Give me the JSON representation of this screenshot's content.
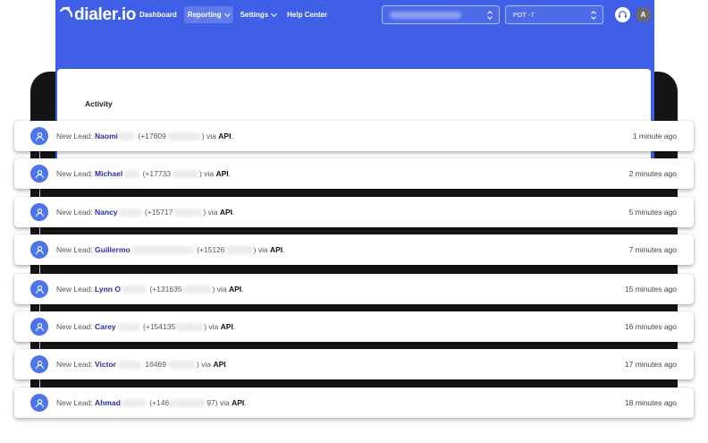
{
  "app": {
    "logo_text": "dialer.io",
    "nav": [
      {
        "label": "Dashboard"
      },
      {
        "label": "Reporting"
      },
      {
        "label": "Settings"
      },
      {
        "label": "Help Center"
      }
    ],
    "timezone": "PDT -7",
    "user_initial": "A"
  },
  "activity": {
    "title": "Activity",
    "prefix": "New Lead:",
    "via_word": "via",
    "activities": [
      {
        "name": "Naomi",
        "phone": "(+17809",
        "phone_end": ")",
        "source": "API",
        "time": "1 minute ago"
      },
      {
        "name": "Michael",
        "phone": "(+17733",
        "phone_end": ")",
        "source": "API",
        "time": "2 minutes ago"
      },
      {
        "name": "Nancy",
        "phone": "(+15717",
        "phone_end": ")",
        "source": "API",
        "time": "5 minutes ago"
      },
      {
        "name": "Guillermo",
        "phone": "(+15126",
        "phone_end": ")",
        "source": "API",
        "time": "7 minutes ago"
      },
      {
        "name": "Lynn O",
        "phone": "(+131635",
        "phone_end": ")",
        "source": "API",
        "time": "15 minutes ago"
      },
      {
        "name": "Carey",
        "phone": "(+154135",
        "phone_end": ")",
        "source": "API",
        "time": "16 minutes ago"
      },
      {
        "name": "Victor",
        "phone": "16469",
        "phone_end": ")",
        "source": "API",
        "time": "17 minutes ago"
      },
      {
        "name": "Ahmad",
        "phone": "(+146",
        "phone_end": "97)",
        "source": "API",
        "time": "18 minutes ago"
      }
    ]
  },
  "colors": {
    "brand": "#3e5fe6",
    "icon_bg": "#4d74ea",
    "lead_name": "#2c2c9c"
  },
  "icons": {
    "lead": "user-icon",
    "support": "headset-icon"
  }
}
